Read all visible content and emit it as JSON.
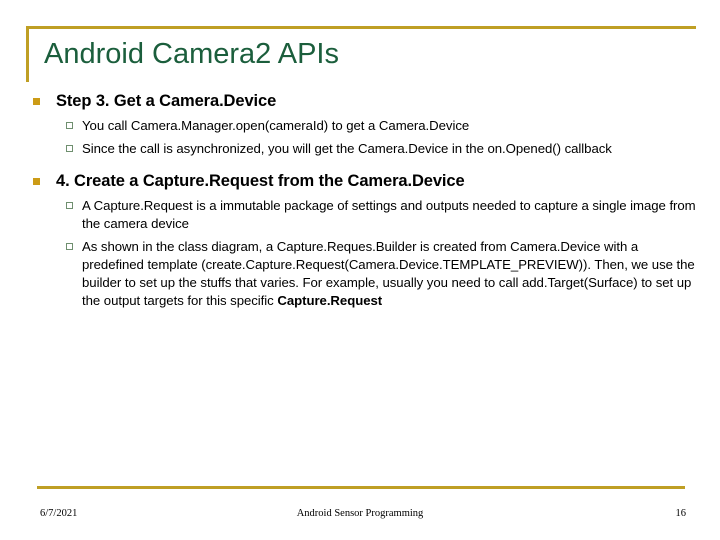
{
  "slide": {
    "title": "Android Camera2 APIs",
    "accent_color": "#bf9f24",
    "title_color": "#1b5e3c",
    "bullet_color": "#cc9b16",
    "subbullet_color": "#6f8f6f",
    "groups": [
      {
        "heading": "Step 3. Get a Camera.Device",
        "items": [
          "You call Camera.Manager.open(cameraId) to get a Camera.Device",
          "Since the call is asynchronized, you will get the Camera.Device in the on.Opened() callback"
        ]
      },
      {
        "heading": "4. Create a Capture.Request from the Camera.Device",
        "items": [
          "A Capture.Request is a immutable package of settings and outputs needed to capture a single image from the camera device",
          "As shown in the class diagram, a Capture.Reques.Builder is created from Camera.Device with a predefined template (create.Capture.Request(Camera.Device.TEMPLATE_PREVIEW)). Then, we use the builder to set up the stuffs that varies. For example, usually you need to call add.Target(Surface) to set up the output targets for this specific "
        ],
        "item_strong_tail": "Capture.Request"
      }
    ]
  },
  "footer": {
    "date": "6/7/2021",
    "center": "Android Sensor Programming",
    "page": "16"
  }
}
